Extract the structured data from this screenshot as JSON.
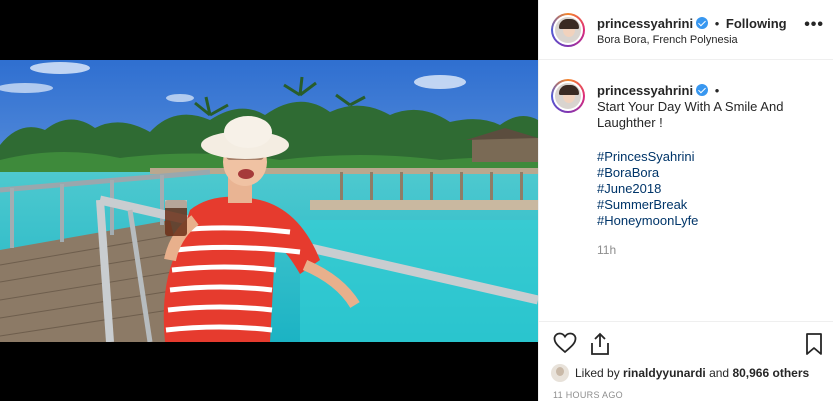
{
  "post": {
    "username": "princessyahrini",
    "following_label": "Following",
    "separator": "•",
    "location": "Bora Bora, French Polynesia",
    "more_label": "•••"
  },
  "caption": {
    "username": "princessyahrini",
    "separator": "•",
    "text": "Start Your Day With A Smile And Laughther !",
    "hashtags": [
      "#PrincesSyahrini",
      "#BoraBora",
      "#June2018",
      "#SummerBreak",
      "#HoneymoonLyfe"
    ],
    "age": "11h"
  },
  "likes": {
    "prefix": "Liked by",
    "user": "rinaldyyunardi",
    "middle": "and",
    "count": "80,966 others"
  },
  "timestamp": "11 HOURS AGO",
  "icons": {
    "like": "heart-outline-icon",
    "share": "share-upload-icon",
    "save": "bookmark-icon",
    "verified": "verified-badge-icon",
    "more": "ellipsis-icon"
  },
  "colors": {
    "verified": "#3897f0",
    "hashtag": "#003569",
    "muted": "#8e8e8e",
    "sky": "#3a78d6",
    "water": "#2ec4c9"
  }
}
